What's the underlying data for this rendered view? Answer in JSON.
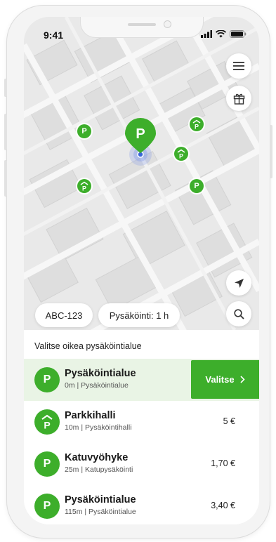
{
  "status_bar": {
    "time": "9:41"
  },
  "map": {
    "main_pin_label": "P",
    "small_pin_label": "P"
  },
  "chips": {
    "plate": "ABC-123",
    "duration": "Pysäköinti: 1 h"
  },
  "sheet": {
    "title": "Valitse oikea pysäköintialue",
    "select_label": "Valitse",
    "items": [
      {
        "name": "Pysäköintialue",
        "sub": "0m | Pysäköintialue",
        "price": "",
        "icon": "parking-icon",
        "selected": true
      },
      {
        "name": "Parkkihalli",
        "sub": "10m | Pysäköintihalli",
        "price": "5 €",
        "icon": "parking-garage-icon",
        "selected": false
      },
      {
        "name": "Katuvyöhyke",
        "sub": "25m | Katupysäköinti",
        "price": "1,70 €",
        "icon": "parking-icon",
        "selected": false
      },
      {
        "name": "Pysäköintialue",
        "sub": "115m | Pysäköintialue",
        "price": "3,40 €",
        "icon": "parking-icon",
        "selected": false
      }
    ]
  },
  "colors": {
    "brand_green": "#3dae2b",
    "selected_bg": "#e9f4e5"
  }
}
